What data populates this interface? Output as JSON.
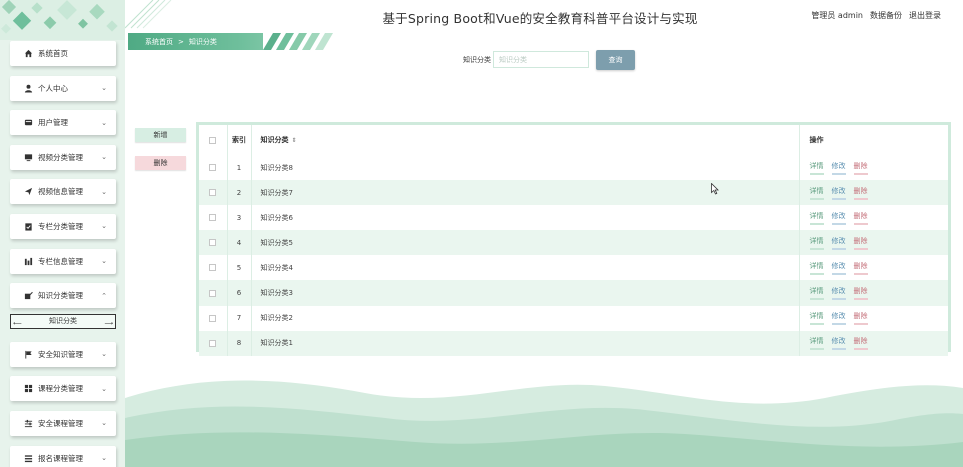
{
  "header": {
    "title": "基于Spring Boot和Vue的安全教育科普平台设计与实现",
    "user_label": "管理员 admin",
    "backup_label": "数据备份",
    "logout_label": "退出登录"
  },
  "breadcrumb": {
    "home": "系统首页",
    "separator": ">",
    "current": "知识分类"
  },
  "sidebar": {
    "items": [
      {
        "label": "系统首页",
        "icon": "home-icon",
        "has_chevron": false
      },
      {
        "label": "个人中心",
        "icon": "user-icon",
        "has_chevron": true
      },
      {
        "label": "用户管理",
        "icon": "card-icon",
        "has_chevron": true
      },
      {
        "label": "视频分类管理",
        "icon": "monitor-icon",
        "has_chevron": true
      },
      {
        "label": "视频信息管理",
        "icon": "send-icon",
        "has_chevron": true
      },
      {
        "label": "专栏分类管理",
        "icon": "clipboard-icon",
        "has_chevron": true
      },
      {
        "label": "专栏信息管理",
        "icon": "chart-icon",
        "has_chevron": true
      },
      {
        "label": "知识分类管理",
        "icon": "edit-icon",
        "has_chevron": true,
        "expanded": true
      },
      {
        "label": "安全知识管理",
        "icon": "flag-icon",
        "has_chevron": true
      },
      {
        "label": "课程分类管理",
        "icon": "grid-icon",
        "has_chevron": true
      },
      {
        "label": "安全课程管理",
        "icon": "sliders-icon",
        "has_chevron": true
      },
      {
        "label": "报名课程管理",
        "icon": "list-icon",
        "has_chevron": true
      }
    ],
    "submenu": {
      "label": "知识分类"
    }
  },
  "search": {
    "label": "知识分类",
    "placeholder": "知识分类",
    "value": "",
    "button_label": "查询"
  },
  "actions": {
    "add_label": "新增",
    "delete_label": "删除"
  },
  "table": {
    "headers": {
      "index": "索引",
      "name": "知识分类",
      "ops": "操作"
    },
    "ops": {
      "detail": "详情",
      "edit": "修改",
      "delete": "删除"
    },
    "rows": [
      {
        "index": "1",
        "name": "知识分类8"
      },
      {
        "index": "2",
        "name": "知识分类7"
      },
      {
        "index": "3",
        "name": "知识分类6"
      },
      {
        "index": "4",
        "name": "知识分类5"
      },
      {
        "index": "5",
        "name": "知识分类4"
      },
      {
        "index": "6",
        "name": "知识分类3"
      },
      {
        "index": "7",
        "name": "知识分类2"
      },
      {
        "index": "8",
        "name": "知识分类1"
      }
    ]
  },
  "colors": {
    "accent": "#4faa84",
    "sidebar_bg": "#e7f3ec",
    "search_button": "#7d9ead",
    "detail": "#5a9b7d",
    "edit": "#5a8fb0",
    "delete": "#c46e78"
  }
}
